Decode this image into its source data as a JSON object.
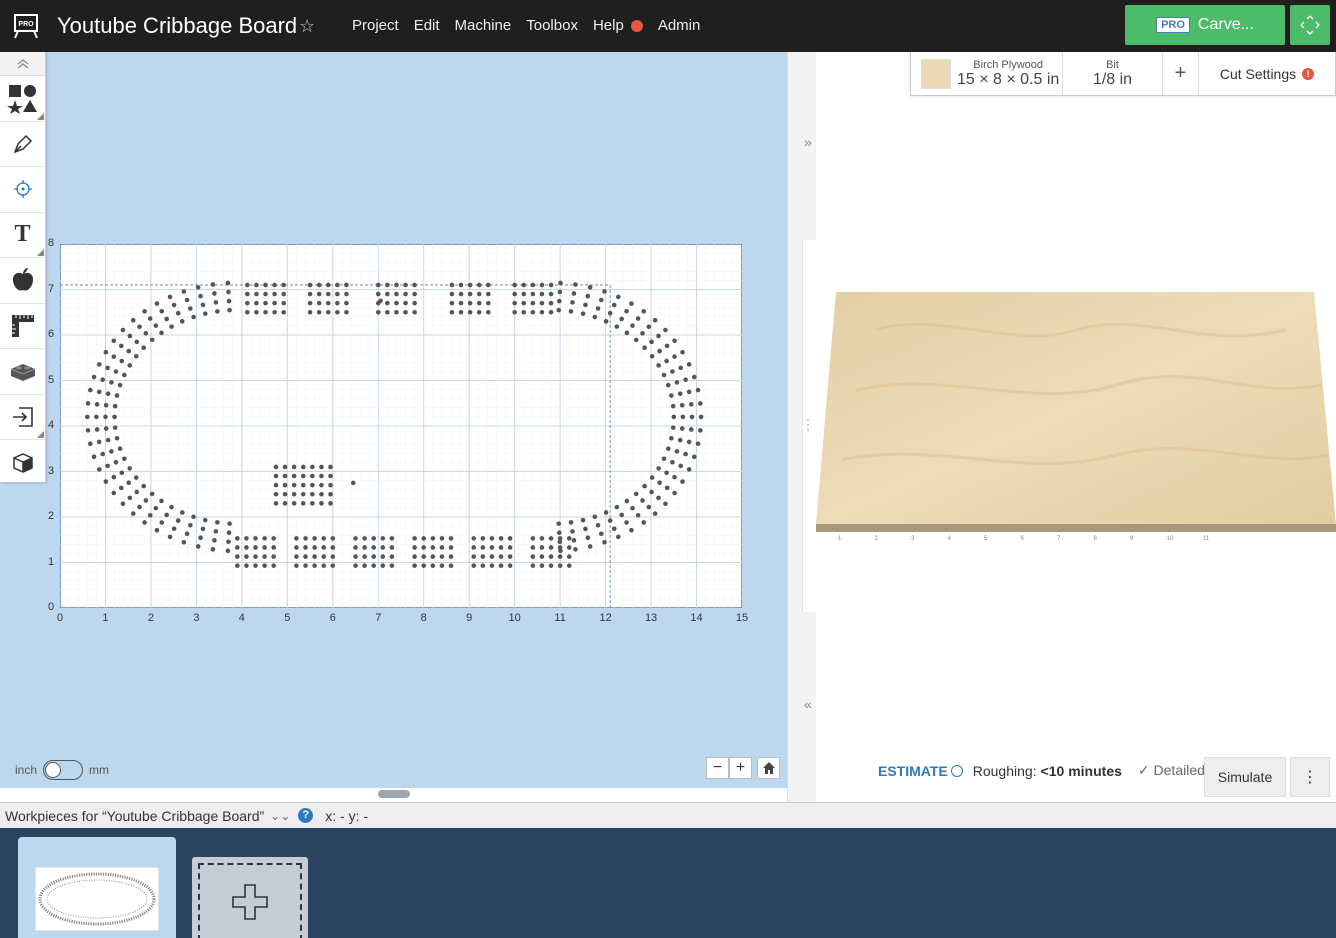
{
  "header": {
    "pro_badge": "PRO",
    "title": "Youtube Cribbage Board",
    "menu": [
      "Project",
      "Edit",
      "Machine",
      "Toolbox",
      "Help",
      "Admin"
    ],
    "carve_badge": "PRO",
    "carve_label": "Carve...",
    "accent_color": "#4cbc6b"
  },
  "toolbar": {
    "tools": [
      "shapes-icon",
      "pen-icon",
      "point-icon",
      "text-icon",
      "apple-icon",
      "ruler-icon",
      "lego-brick-icon",
      "import-icon",
      "cube-icon"
    ]
  },
  "design": {
    "x_ticks": [
      "0",
      "1",
      "2",
      "3",
      "4",
      "5",
      "6",
      "7",
      "8",
      "9",
      "10",
      "11",
      "12",
      "13",
      "14",
      "15"
    ],
    "y_ticks": [
      "0",
      "1",
      "2",
      "3",
      "4",
      "5",
      "6",
      "7",
      "8"
    ],
    "units_left": "inch",
    "units_right": "mm",
    "units_selected": "inch"
  },
  "material": {
    "name": "Birch Plywood",
    "dims": "15 × 8 × 0.5 in",
    "bit_label": "Bit",
    "bit_value": "1/8 in",
    "add": "+",
    "cut_settings": "Cut Settings",
    "warn": "!"
  },
  "preview": {
    "ruler_ticks": [
      "1",
      "2",
      "3",
      "4",
      "5",
      "6",
      "7",
      "8",
      "9",
      "10",
      "11"
    ]
  },
  "estimate": {
    "label": "ESTIMATE",
    "roughing_label": "Roughing:",
    "roughing_value": "<10 minutes",
    "detailed": "Detailed",
    "simulate": "Simulate",
    "more": "⋮"
  },
  "workpieces": {
    "label": "Workpieces for “Youtube Cribbage Board”",
    "help": "?",
    "coords": "x: - y: -"
  }
}
